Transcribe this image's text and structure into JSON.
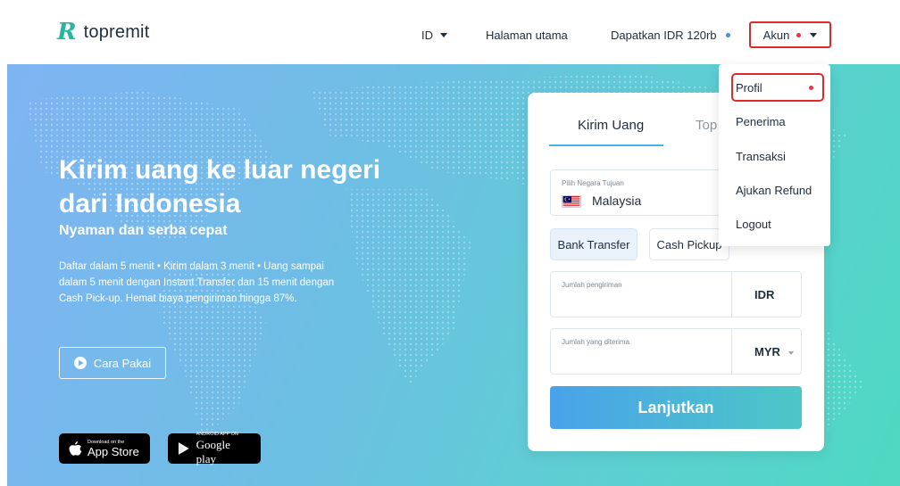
{
  "header": {
    "logo_mark": "R",
    "logo_text": "topremit",
    "lang_label": "ID",
    "home_label": "Halaman utama",
    "earn_label": "Dapatkan IDR 120rb",
    "account_label": "Akun"
  },
  "hero": {
    "title": "Kirim uang ke luar negeri dari Indonesia",
    "subtitle": "Nyaman dan serba cepat",
    "description": "Daftar dalam 5 menit • Kirim dalam 3 menit • Uang sampai dalam 5 menit dengan Instant Transfer dan 15 menit dengan Cash Pick-up. Hemat biaya pengiriman hingga 87%.",
    "how_button": "Cara Pakai",
    "app_store_small": "Download on the",
    "app_store_big": "App Store",
    "google_play_small": "ANDROID APP ON",
    "google_play_big": "Google play"
  },
  "card": {
    "tab_send": "Kirim Uang",
    "tab_topup": "Top",
    "country_label": "Pilih Negara Tujuan",
    "country_value": "Malaysia",
    "method_bank": "Bank Transfer",
    "method_cash": "Cash Pickup",
    "send_amount_label": "Jumlah pengiriman",
    "send_currency": "IDR",
    "recv_amount_label": "Jumlah yang diterima",
    "recv_currency": "MYR",
    "continue_button": "Lanjutkan"
  },
  "account_menu": {
    "items": [
      "Profil",
      "Penerima",
      "Transaksi",
      "Ajukan Refund",
      "Logout"
    ]
  },
  "colors": {
    "brand": "#25b7a4",
    "accent_blue": "#43b5ea",
    "highlight_red": "#e02a2a",
    "notify_red": "#e8354a"
  }
}
